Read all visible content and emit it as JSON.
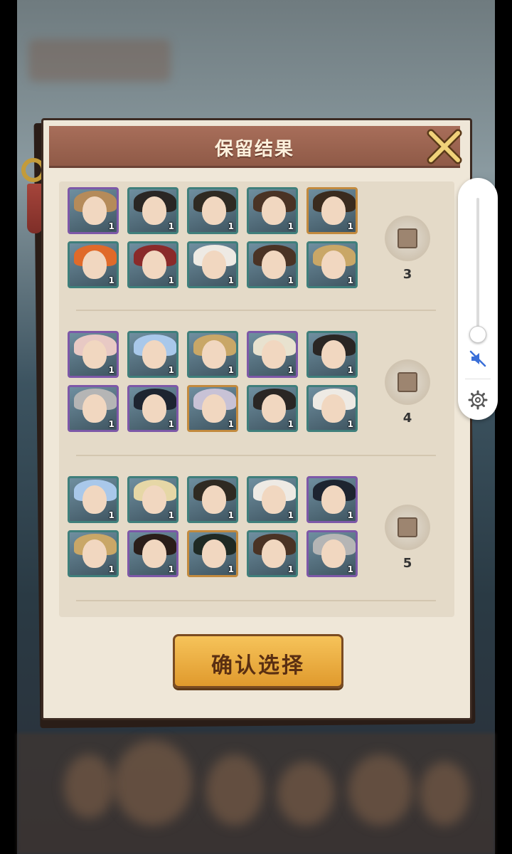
{
  "dialog": {
    "title": "保留结果",
    "confirm_label": "确认选择"
  },
  "groups": [
    {
      "number": "3",
      "rows": [
        [
          {
            "count": "1",
            "frame": "purple",
            "hair": "#b58b5a"
          },
          {
            "count": "1",
            "frame": "teal",
            "hair": "#2a2624"
          },
          {
            "count": "1",
            "frame": "teal",
            "hair": "#2f2a22"
          },
          {
            "count": "1",
            "frame": "teal",
            "hair": "#4a3325"
          },
          {
            "count": "1",
            "frame": "gold",
            "hair": "#3a2b1e"
          }
        ],
        [
          {
            "count": "1",
            "frame": "teal",
            "hair": "#e06a2a"
          },
          {
            "count": "1",
            "frame": "teal",
            "hair": "#8a2a2a"
          },
          {
            "count": "1",
            "frame": "teal",
            "hair": "#eeeae4"
          },
          {
            "count": "1",
            "frame": "teal",
            "hair": "#4a3325"
          },
          {
            "count": "1",
            "frame": "teal",
            "hair": "#c9a767"
          }
        ]
      ]
    },
    {
      "number": "4",
      "rows": [
        [
          {
            "count": "1",
            "frame": "purple",
            "hair": "#e8c9c4"
          },
          {
            "count": "1",
            "frame": "teal",
            "hair": "#a9c8ea"
          },
          {
            "count": "1",
            "frame": "teal",
            "hair": "#c9a767"
          },
          {
            "count": "1",
            "frame": "purple",
            "hair": "#e8e2cf"
          },
          {
            "count": "1",
            "frame": "teal",
            "hair": "#2a2624"
          }
        ],
        [
          {
            "count": "1",
            "frame": "purple",
            "hair": "#b5b5b5"
          },
          {
            "count": "1",
            "frame": "purple",
            "hair": "#1d2430"
          },
          {
            "count": "1",
            "frame": "gold",
            "hair": "#c8c2d6"
          },
          {
            "count": "1",
            "frame": "teal",
            "hair": "#2a2624"
          },
          {
            "count": "1",
            "frame": "teal",
            "hair": "#eeeae4"
          }
        ]
      ]
    },
    {
      "number": "5",
      "rows": [
        [
          {
            "count": "1",
            "frame": "teal",
            "hair": "#a9c8ea"
          },
          {
            "count": "1",
            "frame": "teal",
            "hair": "#e6d7a6"
          },
          {
            "count": "1",
            "frame": "teal",
            "hair": "#2f2a22"
          },
          {
            "count": "1",
            "frame": "teal",
            "hair": "#eeeae4"
          },
          {
            "count": "1",
            "frame": "purple",
            "hair": "#1d2430"
          }
        ],
        [
          {
            "count": "1",
            "frame": "teal",
            "hair": "#c9a767"
          },
          {
            "count": "1",
            "frame": "purple",
            "hair": "#2a1e1a"
          },
          {
            "count": "1",
            "frame": "gold",
            "hair": "#1f2a24"
          },
          {
            "count": "1",
            "frame": "teal",
            "hair": "#4a3325"
          },
          {
            "count": "1",
            "frame": "purple",
            "hair": "#b5b5b5"
          }
        ]
      ]
    }
  ],
  "icons": {
    "close": "close-icon",
    "mute": "volume-mute-icon",
    "settings": "gear-icon"
  },
  "volume_level": 0.0
}
